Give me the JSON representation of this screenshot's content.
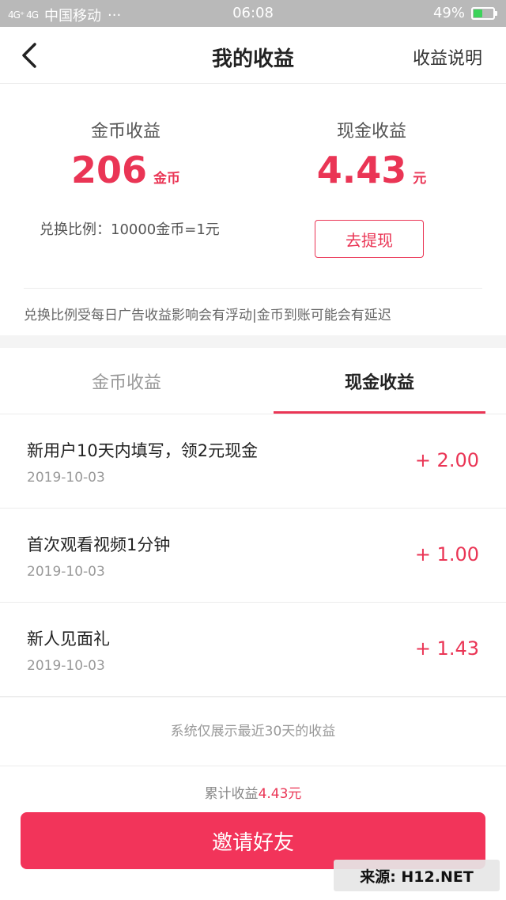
{
  "status_bar": {
    "signal_text": "4G⁺ 4G",
    "carrier": "中国移动",
    "dots": "···",
    "time": "06:08",
    "battery": "49%",
    "battery_level": 0.49
  },
  "nav": {
    "back_icon": "chevron-left-icon",
    "title": "我的收益",
    "help_label": "收益说明"
  },
  "summary": {
    "coin": {
      "label": "金币收益",
      "value": "206",
      "unit": "金币"
    },
    "cash": {
      "label": "现金收益",
      "value": "4.43",
      "unit": "元"
    },
    "ratio_text": "兑换比例：10000金币=1元",
    "withdraw_label": "去提现",
    "notice": "兑换比例受每日广告收益影响会有浮动|金币到账可能会有延迟"
  },
  "tabs": [
    {
      "label": "金币收益",
      "active": false
    },
    {
      "label": "现金收益",
      "active": true
    }
  ],
  "records": [
    {
      "title": "新用户10天内填写，领2元现金",
      "date": "2019-10-03",
      "amount": "+ 2.00"
    },
    {
      "title": "首次观看视频1分钟",
      "date": "2019-10-03",
      "amount": "+ 1.00"
    },
    {
      "title": "新人见面礼",
      "date": "2019-10-03",
      "amount": "+ 1.43"
    }
  ],
  "footnote": "系统仅展示最近30天的收益",
  "bottom": {
    "total_label": "累计收益",
    "total_value": "4.43元",
    "invite_label": "邀请好友"
  },
  "watermark": "来源: H12.NET",
  "colors": {
    "accent": "#ea3555",
    "button": "#f2345a",
    "status_bar": "#b9b9b9"
  }
}
